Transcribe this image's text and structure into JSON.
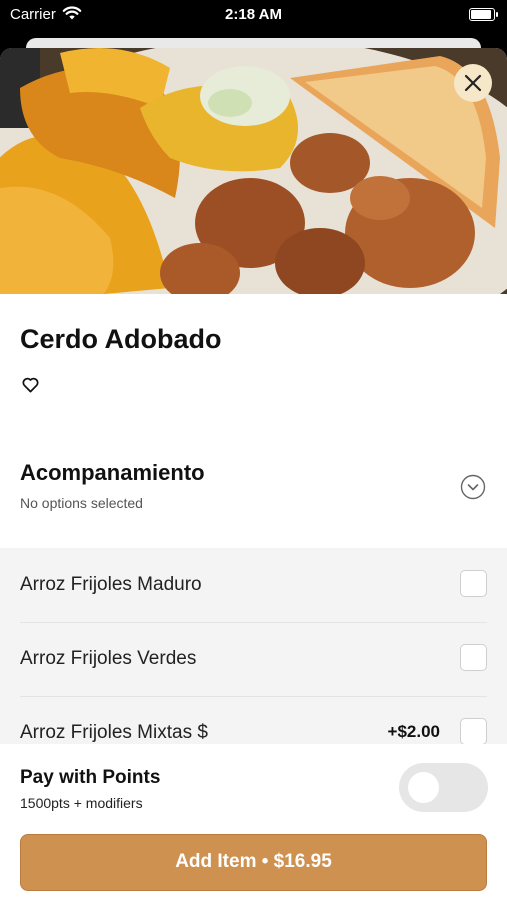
{
  "status_bar": {
    "carrier": "Carrier",
    "time": "2:18 AM"
  },
  "item": {
    "title": "Cerdo Adobado"
  },
  "option_group": {
    "title": "Acompanamiento",
    "subtitle": "No options selected",
    "options": [
      {
        "label": "Arroz Frijoles Maduro",
        "price": ""
      },
      {
        "label": "Arroz Frijoles Verdes",
        "price": ""
      },
      {
        "label": "Arroz Frijoles Mixtas $",
        "price": "+$2.00"
      }
    ]
  },
  "footer": {
    "pay_title": "Pay with Points",
    "pay_subtitle": "1500pts + modifiers",
    "add_button": "Add Item • $16.95"
  },
  "colors": {
    "accent": "#cf9150",
    "close_bg": "#f6e7c8",
    "options_bg": "#f4f4f4"
  }
}
